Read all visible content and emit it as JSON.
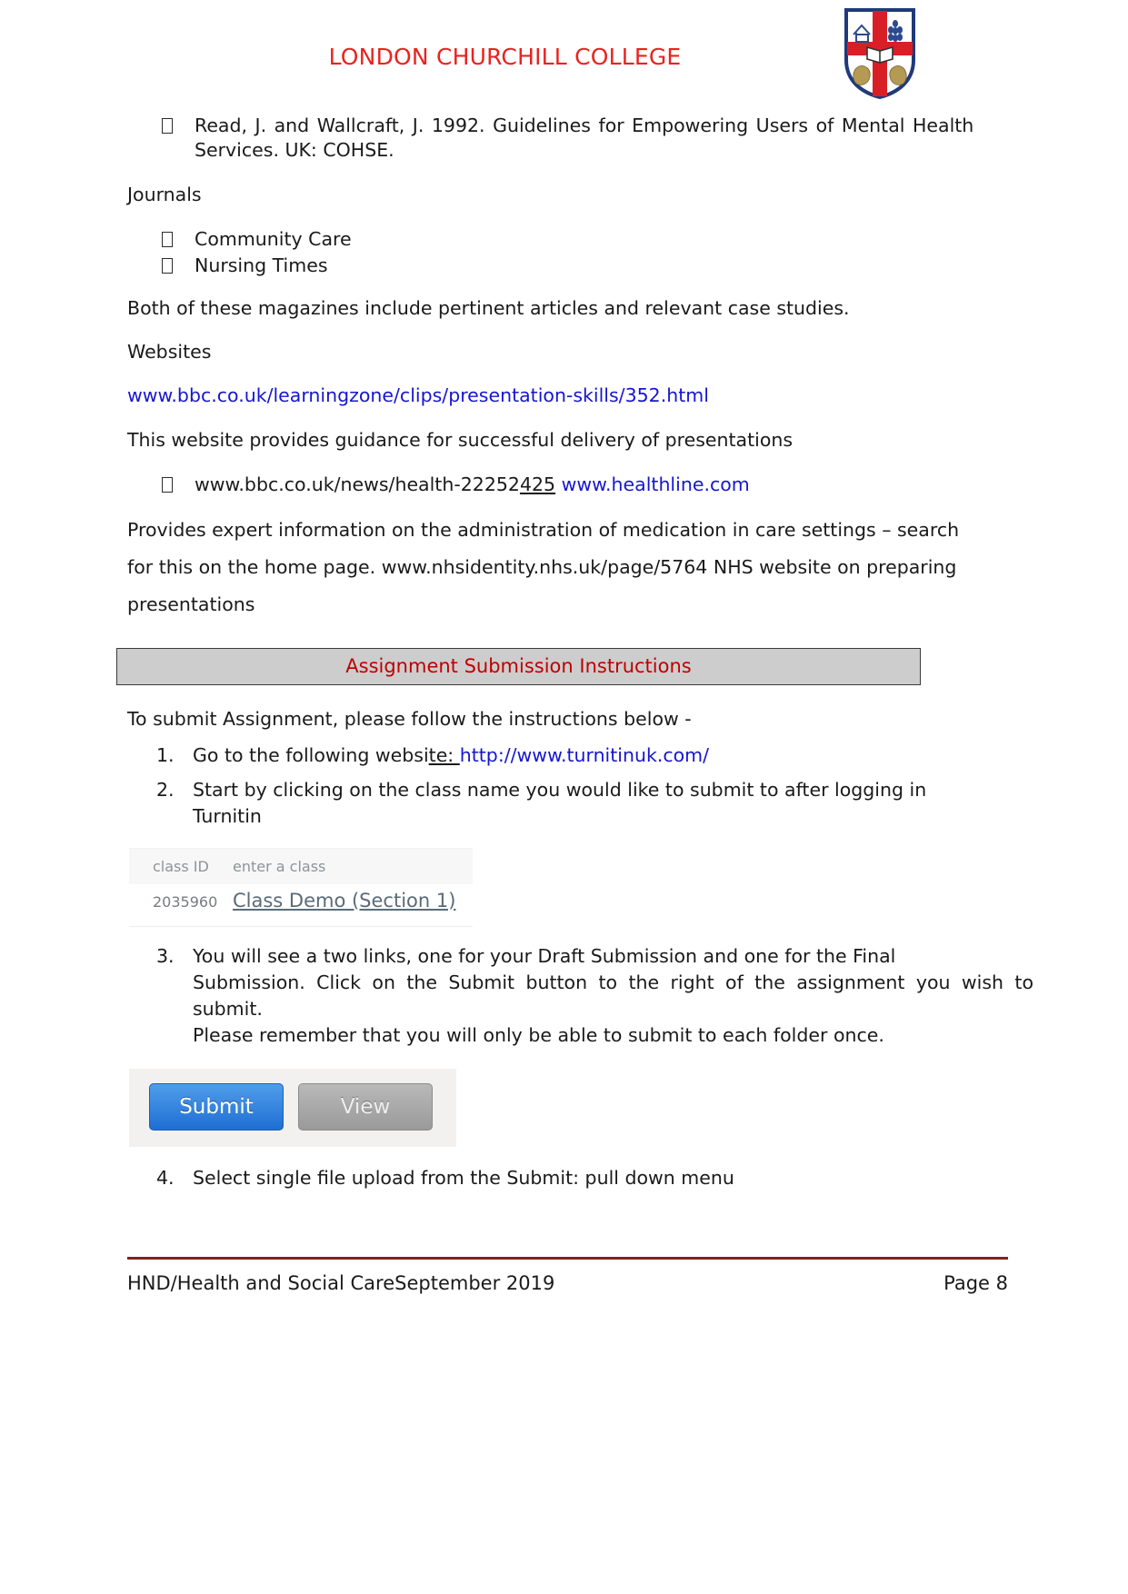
{
  "header": {
    "college_name": "LONDON CHURCHILL COLLEGE",
    "crest_alt": "college-crest"
  },
  "references": {
    "item": {
      "line1": "Read, J. and Wallcraft, J. 1992. Guidelines for Empowering Users of Mental Health",
      "line2": "Services. UK: COHSE."
    }
  },
  "journals": {
    "heading": "Journals",
    "items": [
      "Community Care",
      "Nursing Times"
    ],
    "note": "Both of these magazines include pertinent articles and relevant case studies."
  },
  "websites": {
    "heading": "Websites",
    "bbc_link_underlined": "www.bbc.co.uk/learningzone/clips/presentation-skills/35",
    "bbc_link_tail": "2.html",
    "bbc_description": "This website provides guidance for successful delivery of presentations",
    "bullet_plain": "www.bbc.co.uk/news/health-22252",
    "bullet_underlined_black": "425",
    "bullet_link_underlined": " www.healthlin",
    "bullet_link_tail": "e.com",
    "paragraph_line1": "Provides expert information on the administration of medication in care settings – search",
    "paragraph_line2": "for this on the home page. www.nhsidentity.nhs.uk/page/5764 NHS website on preparing",
    "paragraph_line3": "presentations"
  },
  "submission": {
    "banner_title": "Assignment Submission Instructions",
    "intro": "To submit Assignment, please follow the instructions below -",
    "steps": [
      {
        "number": "1.",
        "text_plain": "Go to the following websi",
        "text_underlined_black": "te:  ",
        "link_underlined": "http://www.turnitinuk.com/",
        "link_tail": ""
      },
      {
        "number": "2.",
        "line1": "Start by clicking on the class name you would like to submit to after logging in",
        "line2": "Turnitin"
      },
      {
        "number": "3.",
        "line1": "You will see a two links, one for your Draft Submission and one for the Final",
        "line2": "Submission. Click on the Submit button to the right of the assignment you wish to submit.",
        "line3": "Please remember that you will only be able to submit to each folder once."
      },
      {
        "number": "4.",
        "line1": "Select single file upload from the Submit: pull down menu"
      }
    ]
  },
  "turnitin_class_table": {
    "col1_header": "class ID",
    "col2_header": "enter a class",
    "row_id": "2035960",
    "row_name": "Class Demo (Section 1)"
  },
  "turnitin_buttons": {
    "submit_label": "Submit",
    "view_label": "View"
  },
  "footer": {
    "course": "HND/Health and Social Care",
    "date": "September 2019",
    "page": "Page 8"
  },
  "colors": {
    "college_red": "#e8231f",
    "banner_red": "#c00000",
    "banner_bg": "#cdcdcd",
    "link_blue": "#1616d0",
    "footer_rule": "#7b2424",
    "submit_blue": "#1f6fd4"
  }
}
